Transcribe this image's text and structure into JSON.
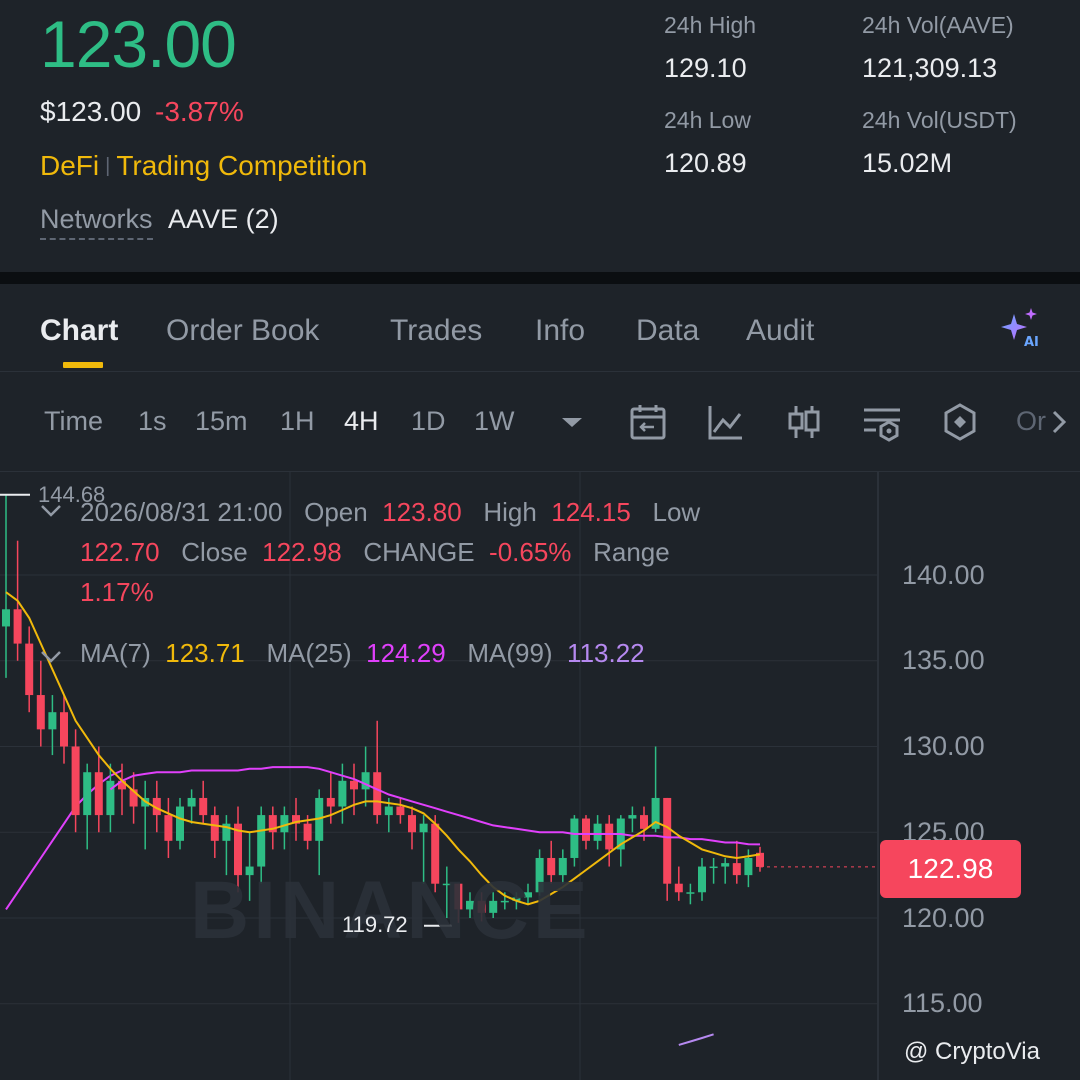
{
  "header": {
    "last_price": "123.00",
    "usd_price": "$123.00",
    "change_pct": "-3.87%",
    "tag_1": "DeFi",
    "tag_sep": "|",
    "tag_2": "Trading Competition",
    "networks_label": "Networks",
    "networks_value": "AAVE (2)",
    "stats": {
      "high_label": "24h High",
      "high_value": "129.10",
      "vol_base_label": "24h Vol(AAVE)",
      "vol_base_value": "121,309.13",
      "low_label": "24h Low",
      "low_value": "120.89",
      "vol_quote_label": "24h Vol(USDT)",
      "vol_quote_value": "15.02M"
    }
  },
  "tabs": [
    "Chart",
    "Order Book",
    "Trades",
    "Info",
    "Data",
    "Audit"
  ],
  "toolbar": {
    "time_label": "Time",
    "intervals": [
      "1s",
      "15m",
      "1H",
      "4H",
      "1D",
      "1W"
    ],
    "active_interval": "4H",
    "overflow_label": "Or"
  },
  "ohlc": {
    "datetime": "2026/08/31 21:00",
    "open_label": "Open",
    "open": "123.80",
    "high_label": "High",
    "high": "124.15",
    "low_label": "Low",
    "low": "122.70",
    "close_label": "Close",
    "close": "122.98",
    "change_label": "CHANGE",
    "change": "-0.65%",
    "range_label": "Range",
    "range": "1.17%"
  },
  "ma": {
    "ma7_label": "MA(7)",
    "ma7": "123.71",
    "ma25_label": "MA(25)",
    "ma25": "124.29",
    "ma99_label": "MA(99)",
    "ma99": "113.22"
  },
  "chart_labels": {
    "high_marker": "144.68",
    "low_marker": "119.72",
    "current_price": "122.98",
    "watermark": "BINANCE",
    "credit": "@ CryptoVia"
  },
  "colors": {
    "up": "#2ebd85",
    "down": "#f6465d",
    "ma7": "#f0b90b",
    "ma25": "#e040fb",
    "ma99": "#b689f0",
    "accent": "#f0b90b"
  },
  "chart_data": {
    "type": "candlestick",
    "interval": "4H",
    "y_axis_ticks": [
      "140.00",
      "135.00",
      "130.00",
      "125.00",
      "120.00",
      "115.00"
    ],
    "ylim": [
      112.5,
      145
    ],
    "candles": [
      {
        "o": 137,
        "h": 144.68,
        "l": 134,
        "c": 138
      },
      {
        "o": 138,
        "h": 142,
        "l": 135,
        "c": 136
      },
      {
        "o": 136,
        "h": 137,
        "l": 132,
        "c": 133
      },
      {
        "o": 133,
        "h": 135,
        "l": 130,
        "c": 131
      },
      {
        "o": 131,
        "h": 133,
        "l": 129.5,
        "c": 132
      },
      {
        "o": 132,
        "h": 133,
        "l": 129,
        "c": 130
      },
      {
        "o": 130,
        "h": 131,
        "l": 125,
        "c": 126
      },
      {
        "o": 126,
        "h": 129,
        "l": 124,
        "c": 128.5
      },
      {
        "o": 128.5,
        "h": 130,
        "l": 125,
        "c": 126
      },
      {
        "o": 126,
        "h": 129,
        "l": 125,
        "c": 128
      },
      {
        "o": 128,
        "h": 129,
        "l": 126,
        "c": 127.5
      },
      {
        "o": 127.5,
        "h": 128.5,
        "l": 125.5,
        "c": 126.5
      },
      {
        "o": 126.5,
        "h": 128,
        "l": 124,
        "c": 127
      },
      {
        "o": 127,
        "h": 128,
        "l": 125,
        "c": 126
      },
      {
        "o": 126,
        "h": 127,
        "l": 123.5,
        "c": 124.5
      },
      {
        "o": 124.5,
        "h": 127,
        "l": 124,
        "c": 126.5
      },
      {
        "o": 126.5,
        "h": 127.5,
        "l": 125.5,
        "c": 127
      },
      {
        "o": 127,
        "h": 128,
        "l": 125.5,
        "c": 126
      },
      {
        "o": 126,
        "h": 126.5,
        "l": 123.5,
        "c": 124.5
      },
      {
        "o": 124.5,
        "h": 126,
        "l": 122.5,
        "c": 125.5
      },
      {
        "o": 125.5,
        "h": 126.5,
        "l": 121.5,
        "c": 122.5
      },
      {
        "o": 122.5,
        "h": 125,
        "l": 121,
        "c": 123
      },
      {
        "o": 123,
        "h": 126.5,
        "l": 122,
        "c": 126
      },
      {
        "o": 126,
        "h": 126.5,
        "l": 124,
        "c": 125
      },
      {
        "o": 125,
        "h": 126.5,
        "l": 124,
        "c": 126
      },
      {
        "o": 126,
        "h": 127,
        "l": 124.5,
        "c": 125.5
      },
      {
        "o": 125.5,
        "h": 126,
        "l": 124,
        "c": 124.5
      },
      {
        "o": 124.5,
        "h": 127.5,
        "l": 122.5,
        "c": 127
      },
      {
        "o": 127,
        "h": 128.5,
        "l": 125.5,
        "c": 126.5
      },
      {
        "o": 126.5,
        "h": 129,
        "l": 125.5,
        "c": 128
      },
      {
        "o": 128,
        "h": 129,
        "l": 126,
        "c": 127.5
      },
      {
        "o": 127.5,
        "h": 130,
        "l": 126.5,
        "c": 128.5
      },
      {
        "o": 128.5,
        "h": 131.5,
        "l": 125.5,
        "c": 126
      },
      {
        "o": 126,
        "h": 127,
        "l": 125,
        "c": 126.5
      },
      {
        "o": 126.5,
        "h": 127,
        "l": 125.5,
        "c": 126
      },
      {
        "o": 126,
        "h": 126.5,
        "l": 124,
        "c": 125
      },
      {
        "o": 125,
        "h": 126,
        "l": 122,
        "c": 125.5
      },
      {
        "o": 125.5,
        "h": 126,
        "l": 121.5,
        "c": 122
      },
      {
        "o": 122,
        "h": 123,
        "l": 120,
        "c": 122
      },
      {
        "o": 122,
        "h": 122,
        "l": 119.72,
        "c": 120.5
      },
      {
        "o": 120.5,
        "h": 121.5,
        "l": 120,
        "c": 121
      },
      {
        "o": 121,
        "h": 121.5,
        "l": 119.8,
        "c": 120.3
      },
      {
        "o": 120.3,
        "h": 121.5,
        "l": 120,
        "c": 121
      },
      {
        "o": 121,
        "h": 121.5,
        "l": 120.5,
        "c": 121
      },
      {
        "o": 121,
        "h": 121.5,
        "l": 120.5,
        "c": 121.2
      },
      {
        "o": 121.2,
        "h": 122,
        "l": 120.8,
        "c": 121.5
      },
      {
        "o": 121.5,
        "h": 124,
        "l": 121.3,
        "c": 123.5
      },
      {
        "o": 123.5,
        "h": 124.5,
        "l": 122,
        "c": 122.5
      },
      {
        "o": 122.5,
        "h": 124,
        "l": 122,
        "c": 123.5
      },
      {
        "o": 123.5,
        "h": 126,
        "l": 123,
        "c": 125.8
      },
      {
        "o": 125.8,
        "h": 126,
        "l": 124,
        "c": 124.5
      },
      {
        "o": 124.5,
        "h": 126,
        "l": 124,
        "c": 125.5
      },
      {
        "o": 125.5,
        "h": 126,
        "l": 123,
        "c": 124
      },
      {
        "o": 124,
        "h": 126,
        "l": 123,
        "c": 125.8
      },
      {
        "o": 125.8,
        "h": 126.5,
        "l": 125,
        "c": 126
      },
      {
        "o": 126,
        "h": 126.5,
        "l": 124.5,
        "c": 125.2
      },
      {
        "o": 125.2,
        "h": 130,
        "l": 125,
        "c": 127
      },
      {
        "o": 127,
        "h": 127,
        "l": 121,
        "c": 122
      },
      {
        "o": 122,
        "h": 123,
        "l": 121,
        "c": 121.5
      },
      {
        "o": 121.5,
        "h": 122,
        "l": 120.8,
        "c": 121.5
      },
      {
        "o": 121.5,
        "h": 123.5,
        "l": 121,
        "c": 123
      },
      {
        "o": 123,
        "h": 123.5,
        "l": 122,
        "c": 123
      },
      {
        "o": 123,
        "h": 123.5,
        "l": 122,
        "c": 123.2
      },
      {
        "o": 123.2,
        "h": 124.5,
        "l": 122,
        "c": 122.5
      },
      {
        "o": 122.5,
        "h": 124,
        "l": 121.8,
        "c": 123.5
      },
      {
        "o": 123.8,
        "h": 124.15,
        "l": 122.7,
        "c": 122.98
      }
    ],
    "ma7": [
      139,
      138.5,
      137.5,
      136,
      134.5,
      133,
      131.5,
      130.5,
      129.5,
      128.7,
      128,
      127.4,
      126.8,
      126.4,
      126.1,
      125.8,
      125.6,
      125.5,
      125.4,
      125.3,
      125.1,
      125,
      125.1,
      125.2,
      125.4,
      125.6,
      125.7,
      125.8,
      126,
      126.3,
      126.6,
      126.8,
      126.8,
      126.7,
      126.6,
      126.4,
      126.1,
      125.5,
      124.8,
      124,
      123.3,
      122.5,
      121.8,
      121.3,
      121,
      120.8,
      121,
      121.4,
      121.8,
      122.3,
      122.8,
      123.3,
      123.8,
      124.3,
      124.7,
      125.1,
      125.6,
      125.3,
      124.8,
      124.4,
      124,
      123.8,
      123.6,
      123.5,
      123.6,
      123.71
    ],
    "ma25": [
      null,
      null,
      null,
      null,
      null,
      null,
      null,
      null,
      null,
      127.5,
      128,
      128.3,
      128.4,
      128.5,
      128.5,
      128.5,
      128.6,
      128.6,
      128.6,
      128.6,
      128.6,
      128.7,
      128.7,
      128.8,
      128.8,
      128.8,
      128.8,
      128.7,
      128.5,
      128.3,
      128.1,
      127.8,
      127.5,
      127.2,
      127,
      126.8,
      126.6,
      126.4,
      126.2,
      126,
      125.8,
      125.6,
      125.4,
      125.3,
      125.2,
      125.1,
      125,
      125,
      125,
      124.9,
      124.9,
      124.9,
      124.9,
      124.9,
      124.8,
      124.8,
      124.8,
      124.7,
      124.7,
      124.6,
      124.6,
      124.5,
      124.4,
      124.4,
      124.3,
      124.29
    ],
    "ma99_segments": [
      {
        "from_index": 0,
        "values": [
          120.5,
          121.5,
          122.5,
          123.5,
          124.5,
          125.5,
          126.5,
          127.2,
          127.8,
          128.3,
          128.6
        ]
      },
      {
        "from_index": 58,
        "values": [
          112.6,
          112.8,
          113.0,
          113.22
        ]
      }
    ]
  }
}
